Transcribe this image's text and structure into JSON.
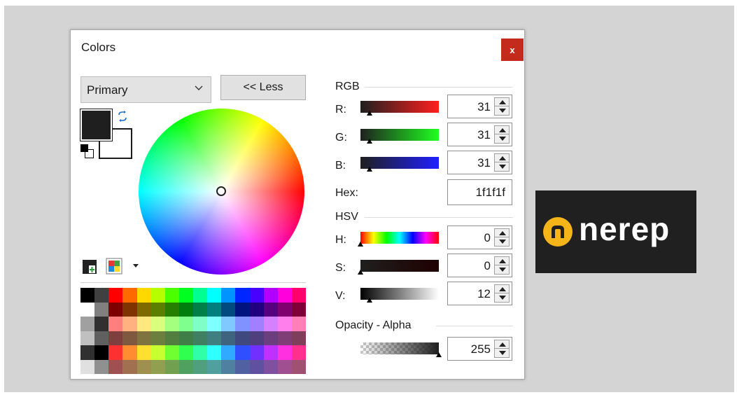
{
  "dialog": {
    "title": "Colors",
    "close_label": "x"
  },
  "color_select": {
    "value": "Primary",
    "icon": "chevron-down-icon"
  },
  "less_button": {
    "label": "<< Less"
  },
  "swatches": {
    "primary_color": "#1f1f1f",
    "secondary_color": "#ffffff"
  },
  "rgb": {
    "section_label": "RGB",
    "r": {
      "label": "R:",
      "value": "31"
    },
    "g": {
      "label": "G:",
      "value": "31"
    },
    "b": {
      "label": "B:",
      "value": "31"
    }
  },
  "hex": {
    "label": "Hex:",
    "value": "1f1f1f"
  },
  "hsv": {
    "section_label": "HSV",
    "h": {
      "label": "H:",
      "value": "0"
    },
    "s": {
      "label": "S:",
      "value": "0"
    },
    "v": {
      "label": "V:",
      "value": "12"
    }
  },
  "opacity": {
    "section_label": "Opacity - Alpha",
    "value": "255"
  },
  "slider_levels": {
    "r": 0.12,
    "g": 0.12,
    "b": 0.12,
    "h": 0.0,
    "s": 0.0,
    "v": 0.12,
    "alpha": 1.0
  },
  "palette": {
    "top_row": [
      "#000000",
      "#404040",
      "#ff0000",
      "#ff6a00",
      "#ffd800",
      "#b6ff00",
      "#4cff00",
      "#00ff21",
      "#00ff90",
      "#00ffff",
      "#0094ff",
      "#0026ff",
      "#4800ff",
      "#b200ff",
      "#ff00dc",
      "#ff006e"
    ],
    "rows": [
      [
        "#ffffff",
        "#808080",
        "#7f0000",
        "#7f3300",
        "#7f6a00",
        "#5b7f00",
        "#267f00",
        "#007f0e",
        "#007f46",
        "#007f7f",
        "#004a7f",
        "#00137f",
        "#21007f",
        "#57007f",
        "#7f006e",
        "#7f0037"
      ],
      [
        "#a0a0a0",
        "#303030",
        "#ff7f7f",
        "#ffb27f",
        "#ffe97f",
        "#daff7f",
        "#a5ff7f",
        "#7fff8e",
        "#7fffc5",
        "#7fffff",
        "#7fc9ff",
        "#7f92ff",
        "#a17fff",
        "#d67fff",
        "#ff7fed",
        "#ff7fb6"
      ],
      [
        "#c0c0c0",
        "#606060",
        "#7f3f3f",
        "#7f593f",
        "#7f743f",
        "#6d7f3f",
        "#527f3f",
        "#3f7f47",
        "#3f7f62",
        "#3f7f7f",
        "#3f647f",
        "#3f497f",
        "#503f7f",
        "#6b3f7f",
        "#7f3f76",
        "#7f3f5b"
      ],
      [
        "#303030",
        "#000000",
        "#ff3030",
        "#ff8c30",
        "#ffe030",
        "#c8ff30",
        "#70ff30",
        "#30ff50",
        "#30ffa8",
        "#30ffff",
        "#30aaff",
        "#3050ff",
        "#7030ff",
        "#c030ff",
        "#ff30e0",
        "#ff3090"
      ],
      [
        "#e0e0e0",
        "#909090",
        "#a05050",
        "#a07050",
        "#a09050",
        "#90a050",
        "#70a050",
        "#50a060",
        "#50a080",
        "#50a0a0",
        "#5080a0",
        "#5060a0",
        "#6050a0",
        "#8050a0",
        "#a05090",
        "#a05070"
      ]
    ]
  },
  "icons": {
    "swap": "swap-arrows-icon",
    "add": "add-color-icon",
    "palette": "palette-icon",
    "menu": "dropdown-arrow-icon"
  },
  "logo": {
    "text": "nerep",
    "mark_color": "#f5b417"
  }
}
